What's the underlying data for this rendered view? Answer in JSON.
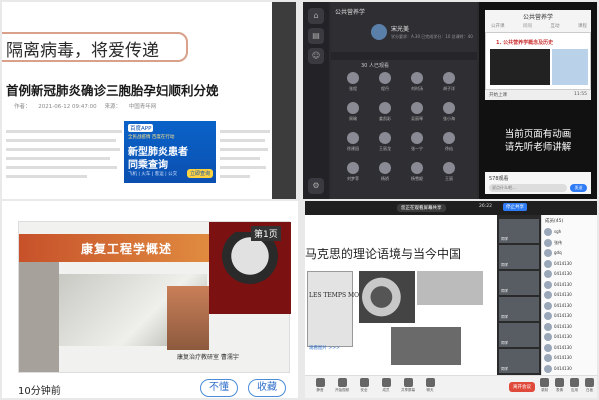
{
  "news": {
    "banner": "隔离病毒，将爱传递",
    "headline": "首例新冠肺炎确诊三胞胎孕妇顺利分娩",
    "meta": [
      "作者：",
      "2021-06-12 09:47:00",
      "来源：",
      "中国青年网"
    ],
    "ad": {
      "brand": "百度APP",
      "subtitle": "全民战疫情 百度在行动",
      "line1": "新型肺炎患者",
      "line2": "同乘查询",
      "small": "飞机 | 火车 | 客运 | 公交",
      "cta": "立即查询"
    }
  },
  "live": {
    "title": "公共营养学",
    "teacher": "宋光美",
    "teacher_sub": "学分要求：A.30 已完成学分：10 总课时：40",
    "progress_badge": "100%",
    "count_label": "30 人已观看",
    "grid_names": [
      "张程",
      "程丹",
      "刘时汤",
      "胡子洋",
      "周瑜",
      "姜凯彩",
      "吴丽琴",
      "张小海",
      "徐建园",
      "王丽龙",
      "张一宁",
      "徐仙",
      "刘梦菲",
      "杨娇",
      "杨雪妮",
      "王丽"
    ],
    "phone_title": "公共营养学",
    "phone_tabs": [
      "公开课",
      "问问",
      "互动",
      "课程"
    ],
    "slide_title": "1. 公共营养学概念及历史",
    "status_left": "开始上课",
    "status_right": "11:55",
    "msg_line1": "当前页面有动画",
    "msg_line2": "请先听老师讲解",
    "viewer_count": "578观看",
    "input_placeholder": "说点什么吧...",
    "send_label": "发送"
  },
  "slide_review": {
    "title": "康复工程学概述",
    "page_badge": "第1页",
    "credit": "康复治疗教研室 曹濡宇",
    "time_ago": "10分钟前",
    "btn_dont_understand": "不懂",
    "btn_favorite": "收藏"
  },
  "meeting": {
    "share_pill": "您正在观看屏幕共享",
    "timer": "26:22",
    "share_btn": "停止共享",
    "heading": "马克思的理论语境与当今中国",
    "image_caption": "LES TEMPS MODERNES",
    "link_text": "观看图片 >>>",
    "video_labels": [
      "同学",
      "同学",
      "同学",
      "同学",
      "同学",
      "同学"
    ],
    "list_header": "成员(45)",
    "members": [
      "sgh",
      "张伟",
      "gdq",
      "0414130",
      "0414130",
      "0414130",
      "0414130",
      "0414130",
      "0414130",
      "0414130",
      "0414130",
      "0414130",
      "0414130",
      "0414130"
    ],
    "toolbar": [
      "静音",
      "开始视频",
      "安全",
      "成员",
      "共享屏幕",
      "聊天",
      "录制",
      "表情",
      "应用",
      "白板"
    ],
    "end_label": "离开会议"
  }
}
